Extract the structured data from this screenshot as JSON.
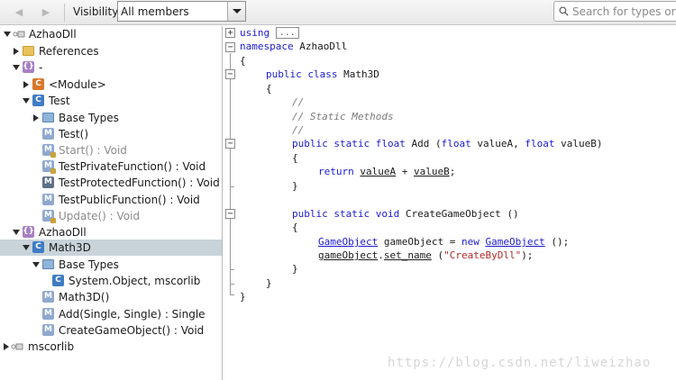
{
  "toolbar": {
    "back_glyph": "◀",
    "forward_glyph": "▶",
    "visibility_label": "Visibility",
    "visibility_value": "All members",
    "search_placeholder": "Search for types or m"
  },
  "tree": {
    "rows": [
      {
        "label": "AzhaoDll",
        "arrow": "expanded",
        "icon": "assembly-icon"
      },
      {
        "label": "References",
        "arrow": "collapsed",
        "icon": "folder-icon"
      },
      {
        "label": "-",
        "arrow": "expanded",
        "icon": "namespace-icon"
      },
      {
        "label": "<Module>",
        "arrow": "collapsed",
        "icon": "module-class-icon"
      },
      {
        "label": "Test",
        "arrow": "expanded",
        "icon": "class-icon"
      },
      {
        "label": "Base Types",
        "arrow": "collapsed",
        "icon": "base-types-folder-icon"
      },
      {
        "label": "Test()",
        "arrow": "none",
        "icon": "method-icon"
      },
      {
        "label": "Start() : Void",
        "arrow": "none",
        "icon": "private-method-icon",
        "muted": true
      },
      {
        "label": "TestPrivateFunction() : Void",
        "arrow": "none",
        "icon": "private-method-icon"
      },
      {
        "label": "TestProtectedFunction() : Void",
        "arrow": "none",
        "icon": "protected-method-icon"
      },
      {
        "label": "TestPublicFunction() : Void",
        "arrow": "none",
        "icon": "method-icon"
      },
      {
        "label": "Update() : Void",
        "arrow": "none",
        "icon": "private-method-icon",
        "muted": true
      },
      {
        "label": "AzhaoDll",
        "arrow": "expanded",
        "icon": "namespace-icon"
      },
      {
        "label": "Math3D",
        "arrow": "expanded",
        "icon": "class-icon",
        "selected": true
      },
      {
        "label": "Base Types",
        "arrow": "expanded",
        "icon": "base-types-folder-icon"
      },
      {
        "label": "System.Object, mscorlib",
        "arrow": "none",
        "icon": "class-icon"
      },
      {
        "label": "Math3D()",
        "arrow": "none",
        "icon": "method-icon"
      },
      {
        "label": "Add(Single, Single) : Single",
        "arrow": "none",
        "icon": "method-icon"
      },
      {
        "label": "CreateGameObject() : Void",
        "arrow": "none",
        "icon": "method-icon"
      },
      {
        "label": "mscorlib",
        "arrow": "collapsed",
        "icon": "assembly-icon"
      }
    ]
  },
  "code": {
    "using_kw": "using",
    "using_collapsed": "...",
    "namespace_kw": "namespace",
    "namespace_name": "AzhaoDll",
    "open_brace": "{",
    "close_brace": "}",
    "class_decl_kw": "public class",
    "class_name": "Math3D",
    "comment_blank": "//",
    "comment_text": "// Static Methods",
    "add_kw": "public static float",
    "add_name": "Add",
    "add_param_kw1": "float",
    "add_param1": "valueA,",
    "add_param_kw2": "float",
    "add_param2": "valueB)",
    "add_open_paren": "(",
    "return_kw": "return",
    "return_a": "valueA",
    "return_plus": "+",
    "return_b": "valueB",
    "return_end": ";",
    "create_kw": "public static void",
    "create_name": "CreateGameObject",
    "create_parens": "()",
    "go_type": "GameObject",
    "go_var": "gameObject =",
    "new_kw": "new",
    "go_ctor": "GameObject",
    "go_ctor_end": "();",
    "setname_obj": "gameObject",
    "setname_dot": ".",
    "setname_member": "set_name",
    "setname_open": "(",
    "setname_str": "\"CreateByDll\"",
    "setname_end": ");"
  },
  "watermark": "https://blog.csdn.net/liweizhao"
}
